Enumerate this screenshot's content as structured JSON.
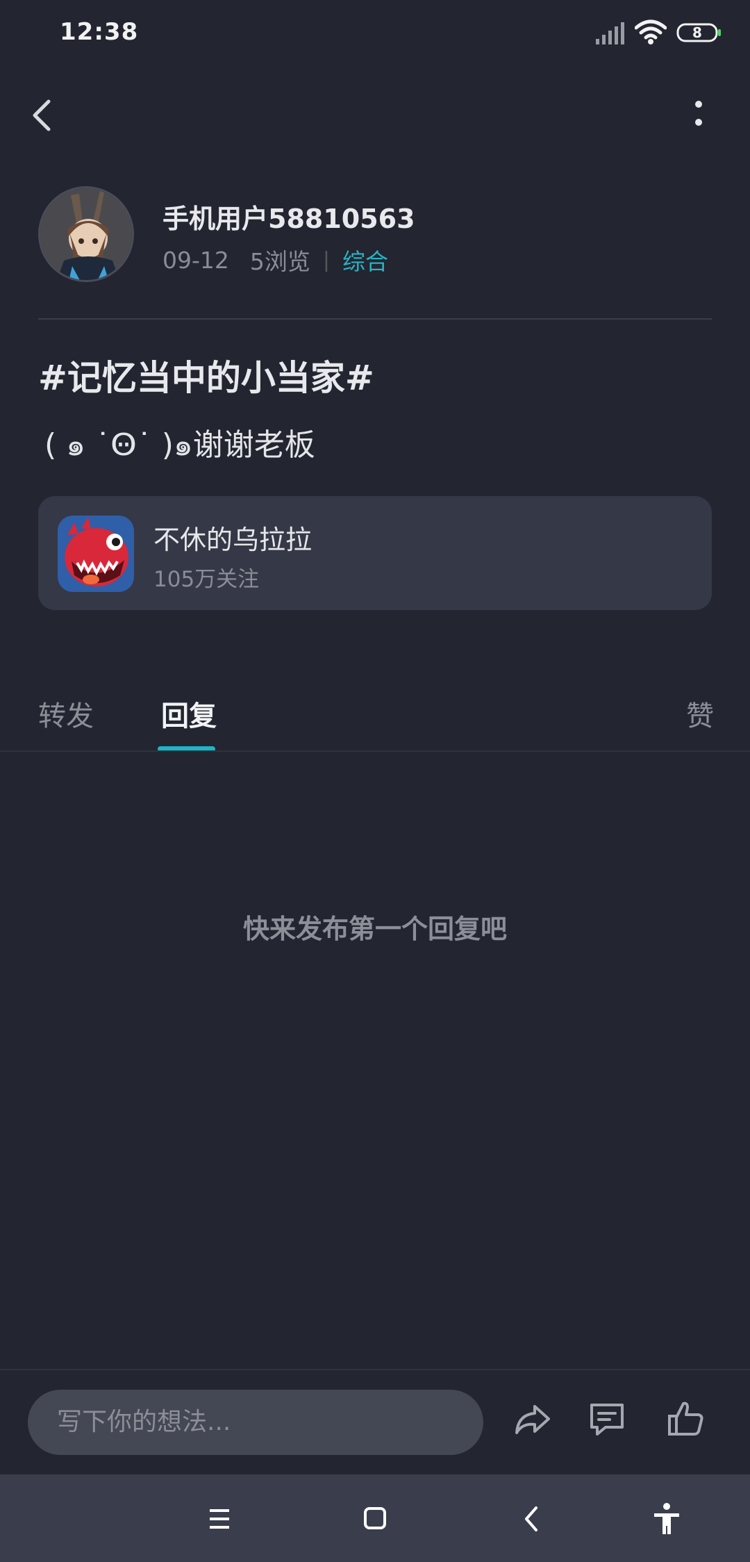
{
  "status_bar": {
    "time": "12:38",
    "battery": "8"
  },
  "post": {
    "author_name": "手机用户58810563",
    "date": "09-12",
    "views": "5浏览",
    "separator": "|",
    "category": "综合",
    "title": "#记忆当中的小当家#",
    "body": "( ๑ ˙Ꙫ˙ )๑谢谢老板"
  },
  "game_card": {
    "name": "不休的乌拉拉",
    "followers": "105万关注"
  },
  "tabs": {
    "forward": "转发",
    "replies": "回复",
    "likes": "赞"
  },
  "empty_state": "快来发布第一个回复吧",
  "comment_bar": {
    "placeholder": "写下你的想法..."
  },
  "colors": {
    "background": "#232530",
    "accent": "#1db5c8",
    "card": "#353846"
  }
}
